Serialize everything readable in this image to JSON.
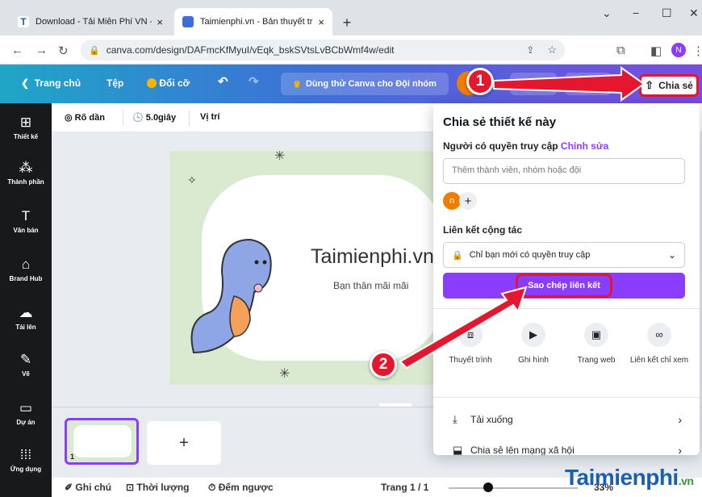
{
  "browser": {
    "tabs": [
      {
        "title": "Download - Tải Miễn Phí VN - Ph",
        "close": "×"
      },
      {
        "title": "Taimienphi.vn - Bản thuyết trình",
        "close": "×"
      }
    ],
    "new_tab": "+",
    "url": "canva.com/design/DAFmcKfMyuI/vEqk_bskSVtsLvBCbWmf4w/edit",
    "window": {
      "minimize": "−",
      "maximize": "☐",
      "close": "✕"
    },
    "profile": "N"
  },
  "header": {
    "home": "Trang chủ",
    "file": "Tệp",
    "resize": "Đổi cỡ",
    "trial": "Dùng thử Canva cho Đội nhóm",
    "share": "Chia sẻ"
  },
  "sidebar": {
    "items": [
      {
        "label": "Thiết kế",
        "icon": "layout-icon"
      },
      {
        "label": "Thành phần",
        "icon": "elements-icon"
      },
      {
        "label": "Văn bản",
        "icon": "text-icon"
      },
      {
        "label": "Brand Hub",
        "icon": "brand-icon"
      },
      {
        "label": "Tải lên",
        "icon": "upload-icon"
      },
      {
        "label": "Vẽ",
        "icon": "draw-icon"
      },
      {
        "label": "Dự án",
        "icon": "folder-icon"
      },
      {
        "label": "Ứng dụng",
        "icon": "apps-icon"
      }
    ]
  },
  "toolbar": {
    "fade": "Rõ dần",
    "duration": "5.0giây",
    "position": "Vị trí"
  },
  "slide": {
    "title": "Taimienphi.vn",
    "subtitle": "Bạn thân mãi mãi"
  },
  "footer": {
    "notes": "Ghi chú",
    "duration": "Thời lượng",
    "timer": "Đếm ngược",
    "page": "Trang 1 / 1",
    "zoom": "33%",
    "page_number": "1"
  },
  "share_panel": {
    "title": "Chia sẻ thiết kế này",
    "access_label": "Người có quyền truy cập",
    "access_edit": "Chỉnh sửa",
    "input_placeholder": "Thêm thành viên, nhóm hoặc đội",
    "avatar": "n",
    "add": "+",
    "collab_label": "Liên kết cộng tác",
    "collab_value": "Chỉ bạn mới có quyền truy cập",
    "copy_link": "Sao chép liên kết",
    "options": [
      "Thuyết trình",
      "Ghi hình",
      "Trang web",
      "Liên kết chỉ xem"
    ],
    "download": "Tải xuống",
    "social": "Chia sẻ lên mạng xã hội"
  },
  "annotations": {
    "step1": "1",
    "step2": "2"
  },
  "watermark": "Taimienphi",
  "watermark_suffix": ".vn",
  "colors": {
    "accent": "#8b3dff",
    "highlight": "#e5172f",
    "sidebar": "#18191b",
    "watermark": "#1b5fb0"
  }
}
